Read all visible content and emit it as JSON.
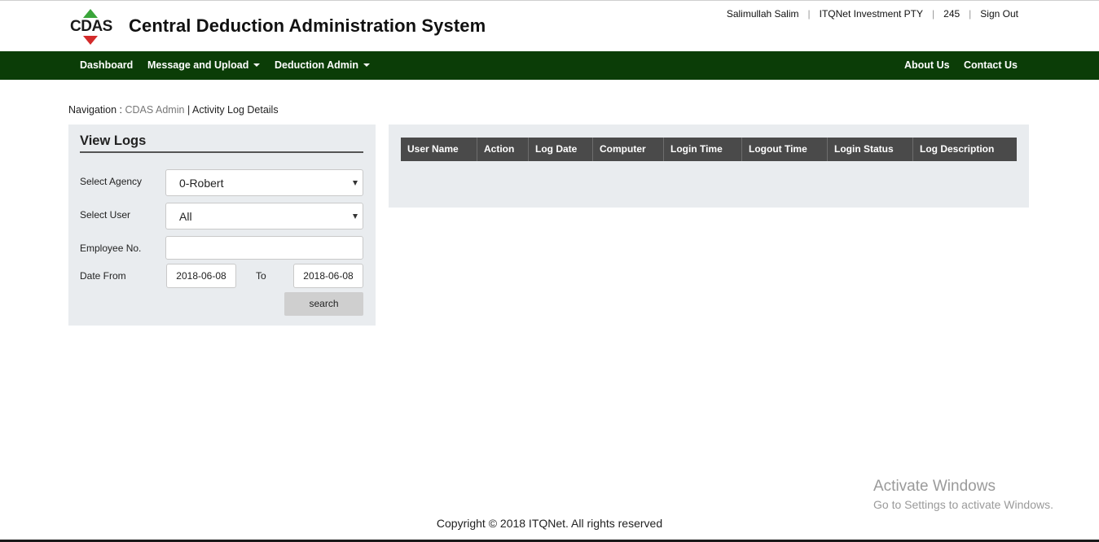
{
  "header": {
    "logo_text": "CDAS",
    "title": "Central Deduction Administration System",
    "user_name": "Salimullah Salim",
    "company": "ITQNet Investment PTY",
    "code": "245",
    "sign_out": "Sign Out",
    "separator": "|"
  },
  "nav": {
    "dashboard": "Dashboard",
    "message_upload": "Message and Upload",
    "deduction_admin": "Deduction Admin",
    "about": "About Us",
    "contact": "Contact Us"
  },
  "breadcrumb": {
    "prefix": "Navigation :",
    "link": "CDAS Admin",
    "separator": "|",
    "current": "Activity Log Details"
  },
  "form": {
    "title": "View Logs",
    "agency_label": "Select Agency",
    "agency_value": "0-Robert",
    "user_label": "Select User",
    "user_value": "All",
    "employee_label": "Employee No.",
    "employee_value": "",
    "date_from_label": "Date From",
    "date_from_value": "2018-06-08",
    "to_label": "To",
    "date_to_value": "2018-06-08",
    "search_label": "search"
  },
  "table": {
    "columns": [
      "User Name",
      "Action",
      "Log Date",
      "Computer",
      "Login Time",
      "Logout Time",
      "Login Status",
      "Log Description"
    ],
    "rows": []
  },
  "watermark": {
    "line1": "Activate Windows",
    "line2": "Go to Settings to activate Windows."
  },
  "footer": {
    "copyright": "Copyright © 2018 ITQNet. All rights reserved"
  },
  "colors": {
    "nav_bg": "#0b3d07",
    "panel_bg": "#e9ecef",
    "table_header_bg": "#4a4a4a",
    "logo_green": "#3aa53a",
    "logo_red": "#d32a2a"
  }
}
